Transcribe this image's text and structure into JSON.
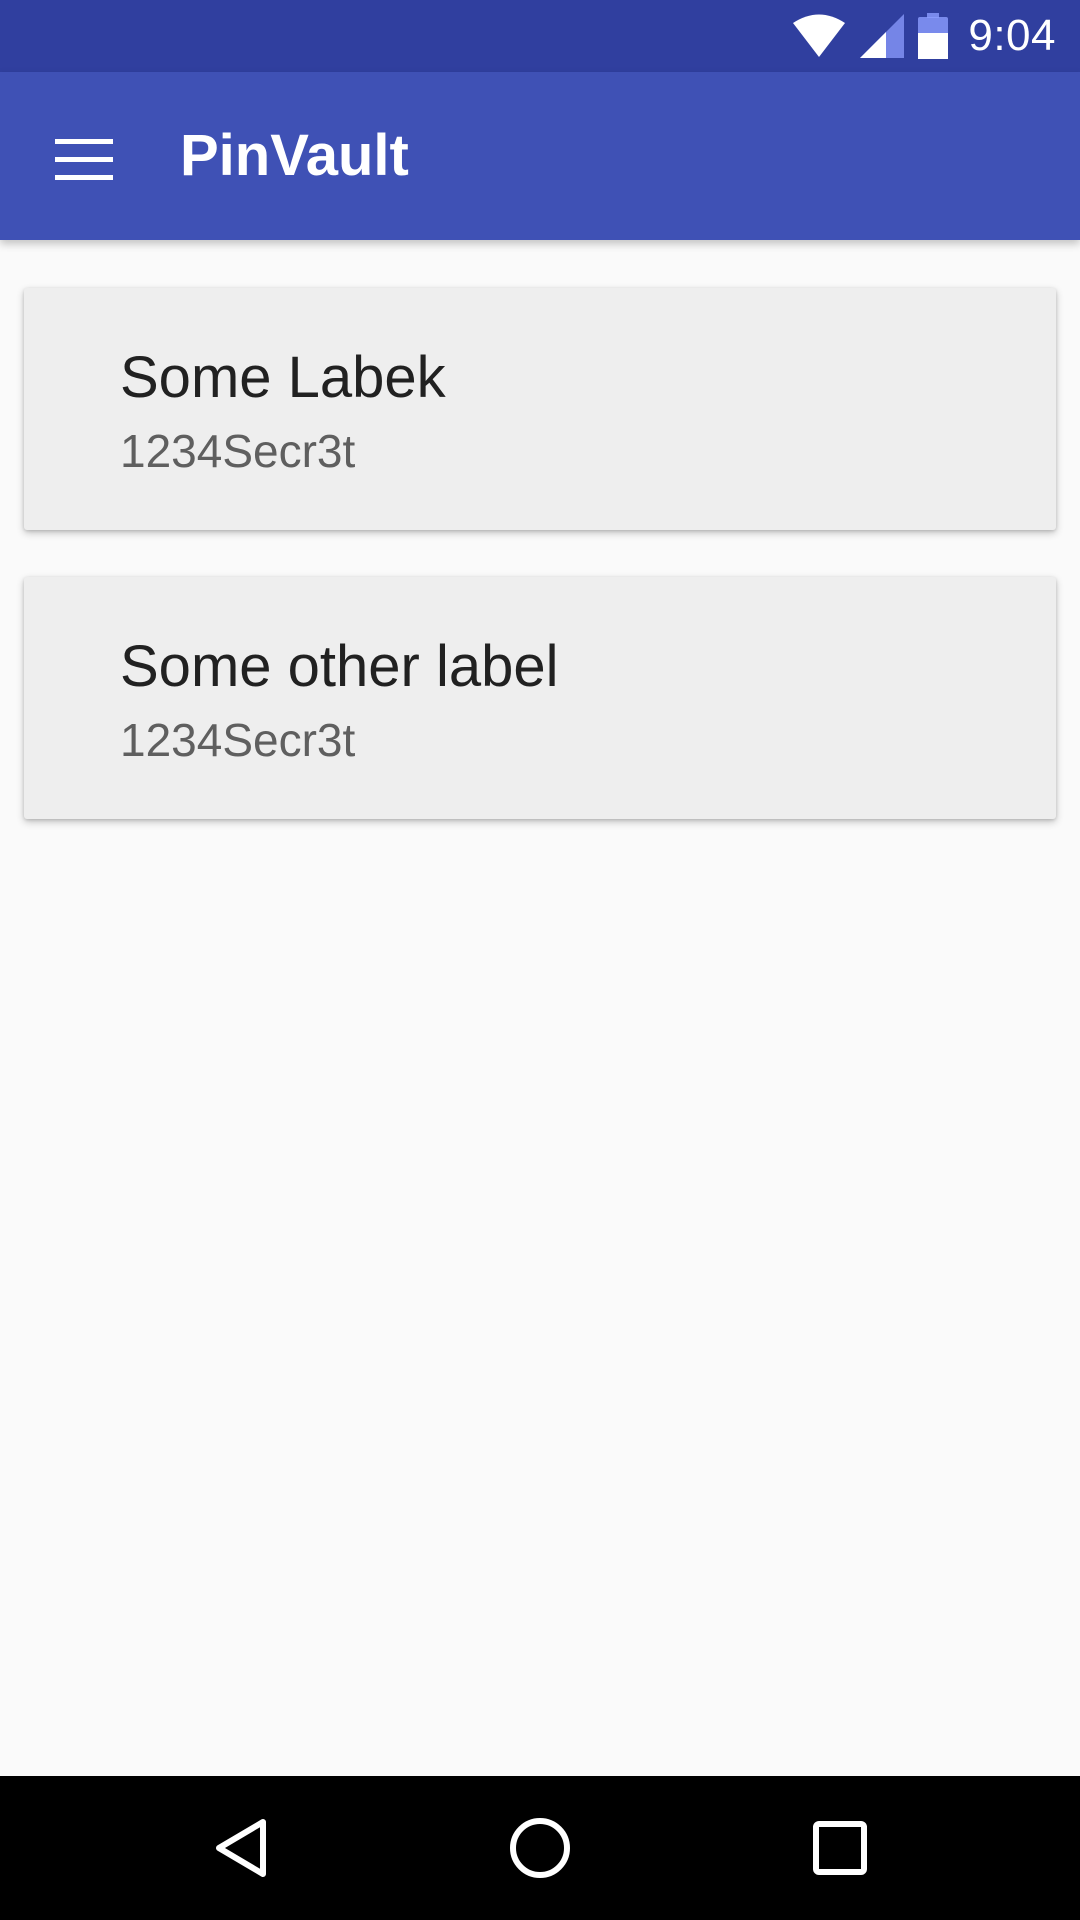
{
  "status_bar": {
    "time": "9:04",
    "icons": [
      "wifi-icon",
      "cell-signal-icon",
      "battery-icon"
    ]
  },
  "app_bar": {
    "title": "PinVault",
    "menu_icon": "hamburger-menu-icon",
    "background_color": "#3f51b5"
  },
  "entries": [
    {
      "label": "Some Labek",
      "secret": "1234Secr3t"
    },
    {
      "label": "Some other label",
      "secret": "1234Secr3t"
    }
  ],
  "nav_bar": {
    "icons": [
      "back-icon",
      "home-icon",
      "recents-icon"
    ]
  },
  "colors": {
    "primary": "#3f51b5",
    "primary_dark": "#303f9f",
    "background": "#fafafa",
    "card": "#eeeeee"
  }
}
